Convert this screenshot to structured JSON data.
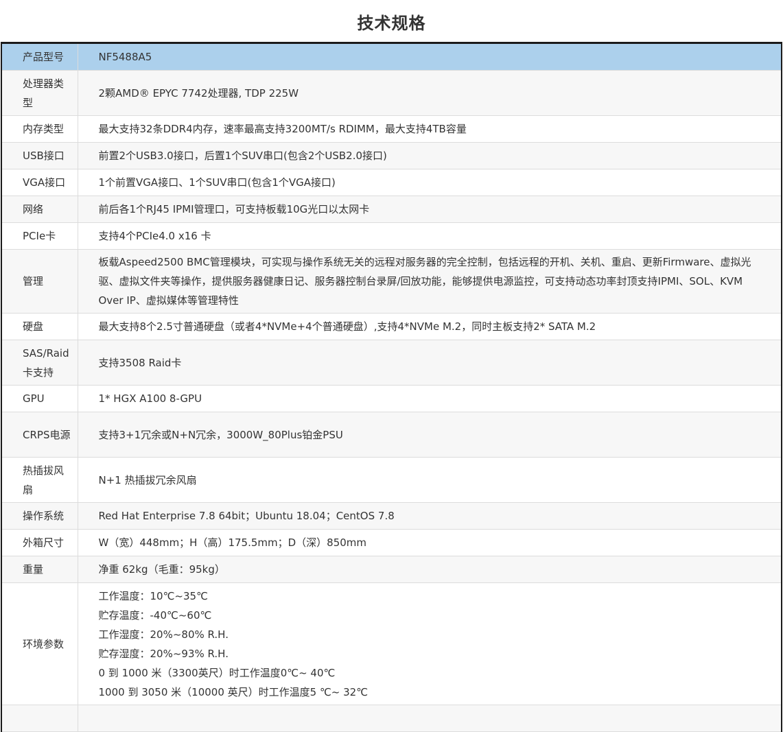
{
  "title": "技术规格",
  "colors": {
    "header_row_bg": "#acd0ec",
    "odd_row_bg": "#f7f7f7",
    "even_row_bg": "#ffffff",
    "table_border": "#1a1a1a",
    "text": "#333333"
  },
  "specs": [
    {
      "label": "产品型号",
      "value": "NF5488A5"
    },
    {
      "label": "处理器类型",
      "value": "2颗AMD® EPYC 7742处理器, TDP 225W"
    },
    {
      "label": "内存类型",
      "value": "最大支持32条DDR4内存，速率最高支持3200MT/s RDIMM，最大支持4TB容量"
    },
    {
      "label": "USB接口",
      "value": "前置2个USB3.0接口，后置1个SUV串口(包含2个USB2.0接口)"
    },
    {
      "label": "VGA接口",
      "value": "1个前置VGA接口、1个SUV串口(包含1个VGA接口)"
    },
    {
      "label": "网络",
      "value": "前后各1个RJ45 IPMI管理口，可支持板载10G光口以太网卡"
    },
    {
      "label": "PCIe卡",
      "value": "支持4个PCIe4.0 x16 卡"
    },
    {
      "label": "管理",
      "value": "板载Aspeed2500 BMC管理模块，可实现与操作系统无关的远程对服务器的完全控制，包括远程的开机、关机、重启、更新Firmware、虚拟光驱、虚拟文件夹等操作，提供服务器健康日记、服务器控制台录屏/回放功能，能够提供电源监控，可支持动态功率封顶支持IPMI、SOL、KVM Over IP、虚拟媒体等管理特性"
    },
    {
      "label": "硬盘",
      "value": "最大支持8个2.5寸普通硬盘（或者4*NVMe+4个普通硬盘）,支持4*NVMe M.2，同时主板支持2* SATA M.2"
    },
    {
      "label": "SAS/Raid卡支持",
      "value": "支持3508 Raid卡"
    },
    {
      "label": "GPU",
      "value": "1* HGX A100 8-GPU"
    },
    {
      "label": "CRPS电源",
      "value": "支持3+1冗余或N+N冗余，3000W_80Plus铂金PSU"
    },
    {
      "label": "热插拔风扇",
      "value": "N+1 热插拔冗余风扇"
    },
    {
      "label": "操作系统",
      "value": "Red Hat Enterprise 7.8 64bit；Ubuntu 18.04；CentOS 7.8"
    },
    {
      "label": "外箱尺寸",
      "value": "W（宽）448mm；H（高）175.5mm；D（深）850mm"
    },
    {
      "label": "重量",
      "value": "净重 62kg（毛重：95kg）"
    }
  ],
  "environment": {
    "label": "环境参数",
    "lines": [
      "工作温度：10℃~35℃",
      "贮存温度：-40℃~60℃",
      "工作湿度：20%~80% R.H.",
      "贮存湿度：20%~93% R.H.",
      "0 到 1000 米（3300英尺）时工作温度0℃~ 40℃",
      "1000 到 3050 米（10000 英尺）时工作温度5 ℃~ 32℃"
    ]
  }
}
